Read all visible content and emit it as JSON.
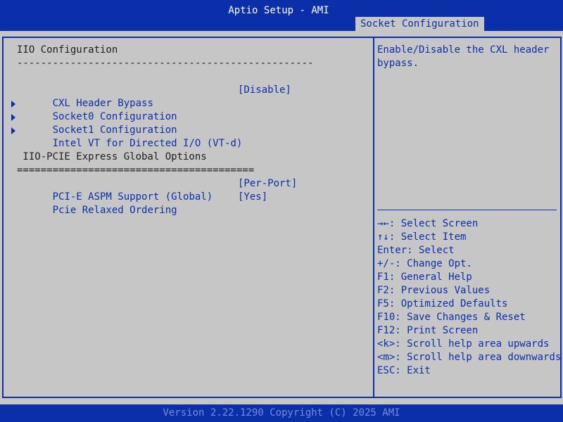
{
  "header": {
    "title": "Aptio Setup - AMI",
    "active_tab": "Socket Configuration"
  },
  "main": {
    "heading": "IIO Configuration",
    "separator_1": "--------------------------------------------------",
    "items": [
      {
        "label": "CXL Header Bypass",
        "value": "[Disable]"
      },
      {
        "label": "Socket0 Configuration"
      },
      {
        "label": "Socket1 Configuration"
      },
      {
        "label": "Intel VT for Directed I/O (VT-d)"
      }
    ],
    "subheading": " IIO-PCIE Express Global Options",
    "separator_2": "========================================",
    "options": [
      {
        "label": "PCI-E ASPM Support (Global)",
        "value": "[Per-Port]"
      },
      {
        "label": "Pcie Relaxed Ordering",
        "value": "[Yes]"
      }
    ]
  },
  "help": {
    "text": "Enable/Disable the CXL header bypass."
  },
  "keys": [
    "→←: Select Screen",
    "↑↓: Select Item",
    "Enter: Select",
    "+/-: Change Opt.",
    "F1: General Help",
    "F2: Previous Values",
    "F5: Optimized Defaults",
    "F10: Save Changes & Reset",
    "F12: Print Screen",
    "<k>: Scroll help area upwards",
    "<m>: Scroll help area downwards",
    "ESC: Exit"
  ],
  "footer": {
    "version": "Version 2.22.1290 Copyright (C) 2025 AMI"
  },
  "colors": {
    "bios_blue": "#0b2fa8",
    "panel_gray": "#c6c6c6",
    "heading_text": "#1e1e1e",
    "footer_text": "#7b8bd4"
  }
}
